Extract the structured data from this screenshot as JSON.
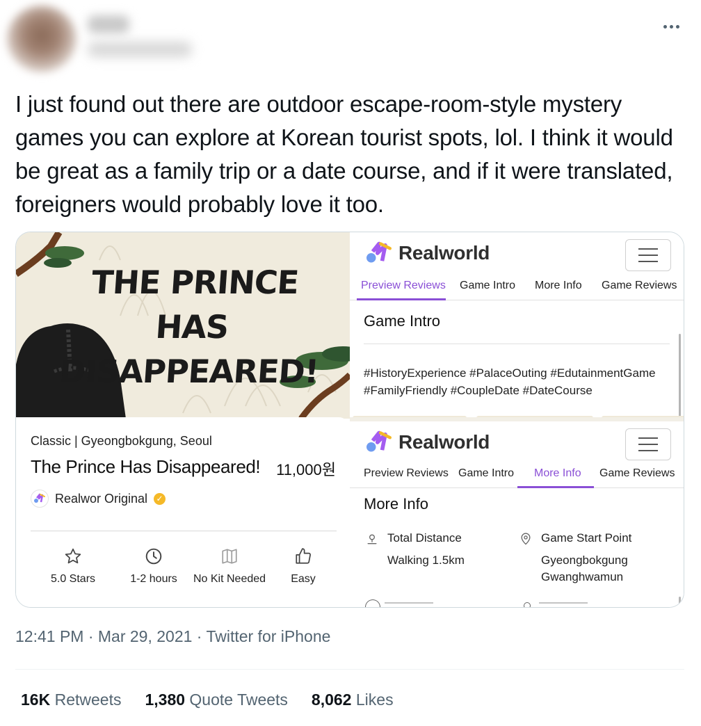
{
  "tweet": {
    "text": "I just found out there are outdoor escape-room-style mystery games you can explore at Korean tourist spots, lol. I think it would be great as a family trip or a date course, and if it were translated, foreigners would probably love it too.",
    "more_icon": "more-horizontal-icon",
    "meta": "12:41 PM · Mar 29, 2021 · Twitter for iPhone",
    "stats": {
      "retweets_count": "16K",
      "retweets_label": "Retweets",
      "quotes_count": "1,380",
      "quotes_label": "Quote Tweets",
      "likes_count": "8,062",
      "likes_label": "Likes"
    }
  },
  "poster": {
    "title_line1": "THE PRINCE HAS",
    "title_line2": "DISAPPEARED!"
  },
  "game_card": {
    "category": "Classic | Gyeongbokgung, Seoul",
    "title": "The Prince Has Disappeared!",
    "price": "11,000원",
    "brand": "Realwor Original",
    "stats": [
      {
        "icon": "star-icon",
        "label": "5.0 Stars"
      },
      {
        "icon": "clock-icon",
        "label": "1-2 hours"
      },
      {
        "icon": "map-icon",
        "label": "No Kit Needed"
      },
      {
        "icon": "thumbs-up-icon",
        "label": "Easy"
      }
    ]
  },
  "app": {
    "logo_text": "Realworld",
    "tabs": [
      "Preview Reviews",
      "Game Intro",
      "More Info",
      "Game Reviews"
    ]
  },
  "panel_intro": {
    "active_tab": "Preview Reviews",
    "section_title": "Game Intro",
    "tags_line1": "#HistoryExperience #PalaceOuting #EdutainmentGame",
    "tags_line2": "#FamilyFriendly #CoupleDate #DateCourse"
  },
  "panel_more": {
    "active_tab": "More Info",
    "section_title": "More Info",
    "distance_label": "Total Distance",
    "distance_value": "Walking 1.5km",
    "start_label": "Game Start Point",
    "start_value_line1": "Gyeongbokgung",
    "start_value_line2": "Gwanghwamun"
  },
  "colors": {
    "accent_purple": "#8a4fd6",
    "verified_gold": "#f5b928",
    "twitter_gray": "#536471"
  }
}
